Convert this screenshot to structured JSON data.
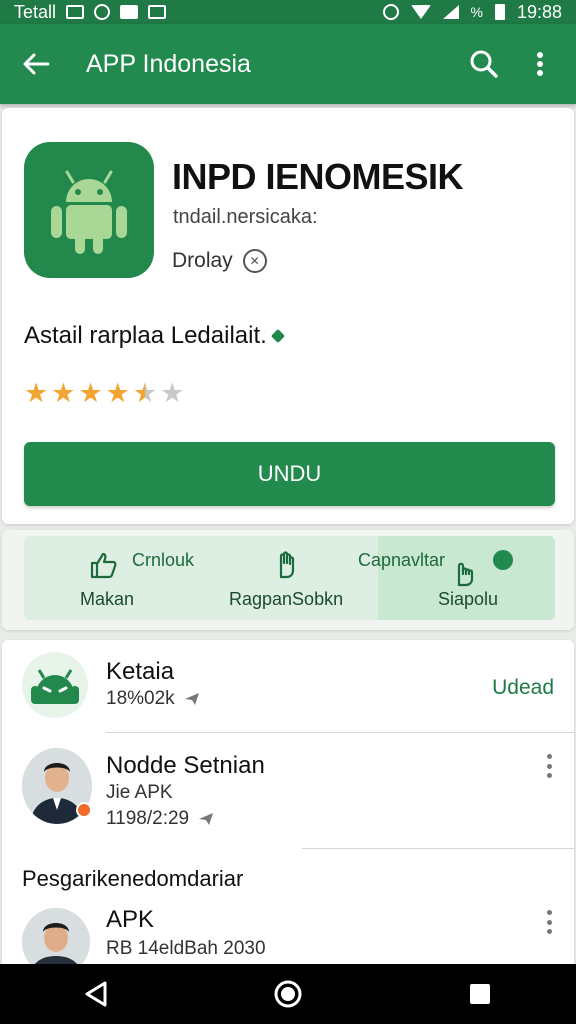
{
  "status_bar": {
    "carrier": "Tetall",
    "time": "19:88",
    "percent_glyph": "%"
  },
  "app_bar": {
    "title": "APP Indonesia",
    "back_icon": "arrow-left-icon",
    "search_icon": "search-icon",
    "menu_icon": "more-vert-icon"
  },
  "app": {
    "name": "INPD IENOMESIK",
    "developer": "tndail.nersicaka:",
    "category": "Drolay",
    "description": "Astail rarplaa Ledailait.",
    "rating": 4.5,
    "rating_max": 5,
    "install_label": "UNDU",
    "brand_color": "#22894f"
  },
  "actions": [
    {
      "top": "Crnlouk",
      "bottom": "Makan",
      "icon": "thumbs-up-icon"
    },
    {
      "top": "",
      "bottom": "RagpanSobkn",
      "icon": "hand-icon"
    },
    {
      "top": "Capnavltar",
      "bottom": "Siapolu",
      "icon": "pointer-hand-icon"
    }
  ],
  "list": {
    "items": [
      {
        "title": "Ketaia",
        "subtitle": "18%02k",
        "action": "Udead",
        "avatar": "android-robot-avatar"
      },
      {
        "title": "Nodde Setnian",
        "subtitle": "Jie APK",
        "subtitle2": "1198/2:29",
        "avatar": "person-avatar"
      }
    ],
    "section_title": "Pesgarikenedomdariar",
    "items2": [
      {
        "title": "APK",
        "subtitle": "RB 14eldBah 2030",
        "avatar": "person-avatar"
      }
    ]
  },
  "nav": {
    "back": "back-triangle-icon",
    "home": "home-circle-icon",
    "recents": "recents-square-icon"
  }
}
